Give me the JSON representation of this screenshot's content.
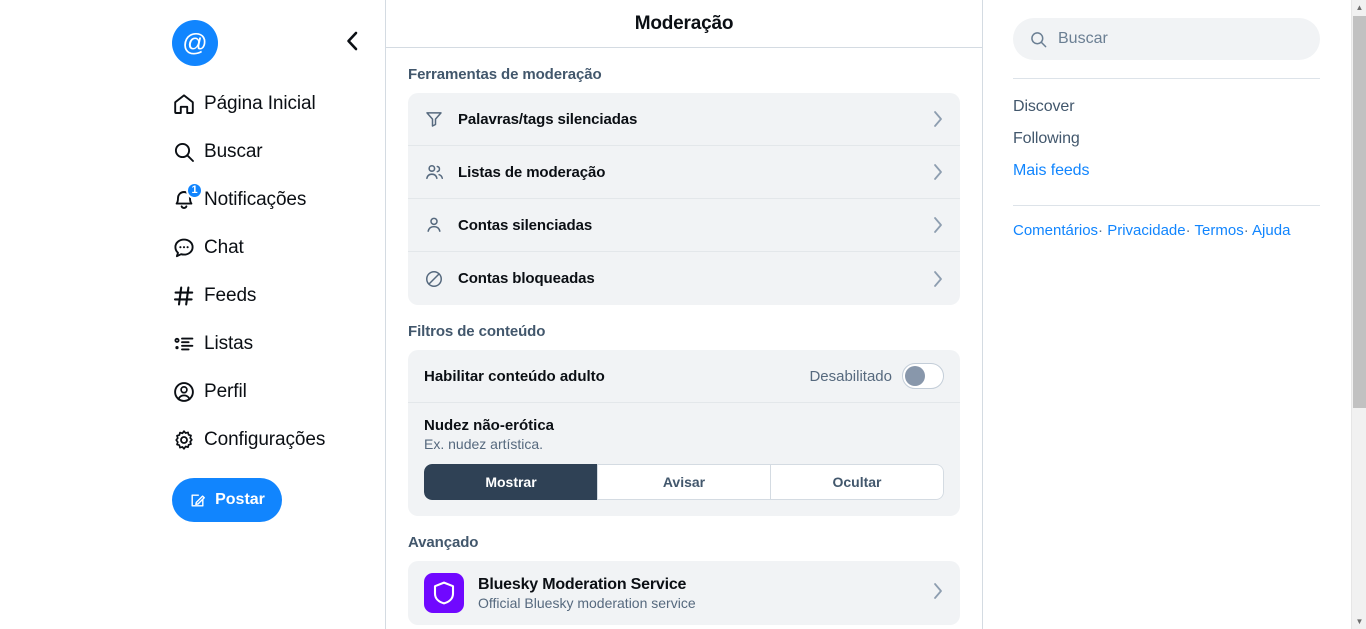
{
  "sidebar": {
    "avatar_glyph": "@",
    "collapse_icon": "chevron-left-icon",
    "items": [
      {
        "label": "Página Inicial",
        "icon": "home-icon",
        "badge": ""
      },
      {
        "label": "Buscar",
        "icon": "search-icon",
        "badge": ""
      },
      {
        "label": "Notificações",
        "icon": "bell-icon",
        "badge": "1"
      },
      {
        "label": "Chat",
        "icon": "chat-bubble-icon",
        "badge": ""
      },
      {
        "label": "Feeds",
        "icon": "hashtag-icon",
        "badge": ""
      },
      {
        "label": "Listas",
        "icon": "list-icon",
        "badge": ""
      },
      {
        "label": "Perfil",
        "icon": "user-circle-icon",
        "badge": ""
      },
      {
        "label": "Configurações",
        "icon": "gear-icon",
        "badge": ""
      }
    ],
    "post_button": "Postar",
    "post_icon": "compose-icon"
  },
  "main": {
    "title": "Moderação",
    "sections": {
      "tools": {
        "heading": "Ferramentas de moderação",
        "rows": [
          {
            "label": "Palavras/tags silenciadas",
            "icon": "funnel-icon"
          },
          {
            "label": "Listas de moderação",
            "icon": "people-icon"
          },
          {
            "label": "Contas silenciadas",
            "icon": "person-icon"
          },
          {
            "label": "Contas bloqueadas",
            "icon": "block-circle-icon"
          }
        ]
      },
      "filters": {
        "heading": "Filtros de conteúdo",
        "adult_toggle": {
          "label": "Habilitar conteúdo adulto",
          "state_text": "Desabilitado",
          "enabled": false
        },
        "items": [
          {
            "name": "Nudez não-erótica",
            "description": "Ex. nudez artística.",
            "options": [
              "Mostrar",
              "Avisar",
              "Ocultar"
            ],
            "selected": "Mostrar"
          }
        ]
      },
      "advanced": {
        "heading": "Avançado",
        "services": [
          {
            "title": "Bluesky Moderation Service",
            "subtitle": "Official Bluesky moderation service",
            "icon": "shield-icon",
            "icon_color": "#7008ff"
          }
        ]
      }
    }
  },
  "right": {
    "search": {
      "placeholder": "Buscar",
      "icon": "search-icon"
    },
    "feed_links": [
      {
        "label": "Discover",
        "highlight": false
      },
      {
        "label": "Following",
        "highlight": false
      },
      {
        "label": "Mais feeds",
        "highlight": true
      }
    ],
    "footer": {
      "links": [
        "Comentários",
        "Privacidade",
        "Termos",
        "Ajuda"
      ],
      "separator": "·"
    }
  },
  "scrollbar": {
    "up_arrow": "▲",
    "down_arrow": "▼"
  },
  "colors": {
    "accent": "#1185fe",
    "card_bg": "#f1f3f5",
    "selected_segment": "#2f4155",
    "muted_text": "#56697e",
    "border": "#d4dbe2"
  }
}
